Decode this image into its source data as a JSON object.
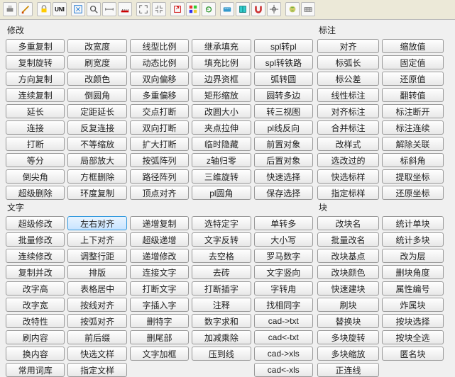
{
  "toolbar": [
    {
      "name": "print-icon"
    },
    {
      "name": "brush-icon"
    },
    {
      "name": "lock-icon"
    },
    {
      "name": "unit-icon"
    },
    {
      "name": "zoom-extents-icon"
    },
    {
      "name": "zoom-icon"
    },
    {
      "name": "measure-icon"
    },
    {
      "name": "ruler-icon"
    },
    {
      "name": "fullscreen-icon"
    },
    {
      "name": "contract-icon"
    },
    {
      "name": "export-icon"
    },
    {
      "name": "colors-icon"
    },
    {
      "name": "refresh-icon"
    },
    {
      "name": "keyboard-icon"
    },
    {
      "name": "book-icon"
    },
    {
      "name": "magnet-icon"
    },
    {
      "name": "crosshair-icon"
    },
    {
      "name": "globe-icon"
    },
    {
      "name": "grid-icon"
    }
  ],
  "sections": {
    "modify": {
      "title": "修改",
      "cols": 5,
      "buttons": [
        "多重复制",
        "改宽度",
        "线型比例",
        "继承填充",
        "spl转pl",
        "复制旋转",
        "刷宽度",
        "动态比例",
        "填充比例",
        "spl转铁路",
        "方向复制",
        "改颜色",
        "双向偏移",
        "边界资框",
        "弧转圆",
        "连续复制",
        "倒圆角",
        "多重偏移",
        "矩形缩放",
        "圆转多边",
        "延长",
        "定距延长",
        "交点打断",
        "改圆大小",
        "转三视图",
        "连接",
        "反复连接",
        "双向打断",
        "夹点拉伸",
        "pl线反向",
        "打断",
        "不等缩放",
        "扩大打断",
        "临时隐藏",
        "前置对象",
        "等分",
        "局部放大",
        "按弧阵列",
        "z轴归零",
        "后置对象",
        "倒尖角",
        "方框删除",
        "路径阵列",
        "三维旋转",
        "快速选择",
        "超级删除",
        "环度复制",
        "顶点对齐",
        "pl圆角",
        "保存选择"
      ]
    },
    "text": {
      "title": "文字",
      "cols": 5,
      "highlight": "左右对齐",
      "buttons": [
        "超级修改",
        "左右对齐",
        "递增复制",
        "选特定字",
        "单转多",
        "批量修改",
        "上下对齐",
        "超级递增",
        "文字反转",
        "大小写",
        "连续修改",
        "调整行距",
        "递增修改",
        "去空格",
        "罗马数字",
        "复制并改",
        "排版",
        "连接文字",
        "去砖",
        "文字竖向",
        "改字高",
        "表格居中",
        "打断文字",
        "打断插字",
        "字转甪",
        "改字宽",
        "按线对齐",
        "字插入字",
        "注释",
        "找相同字",
        "改特性",
        "按弧对齐",
        "删特字",
        "数字求和",
        "cad->txt",
        "刷内容",
        "前后缀",
        "删尾部",
        "加减乘除",
        "cad<-txt",
        "换内容",
        "快选文样",
        "文字加框",
        "压到线",
        "cad->xls",
        "常用词库",
        "指定文样",
        "",
        "",
        "cad<-xls"
      ]
    },
    "annot": {
      "title": "标注",
      "cols": 2,
      "buttons": [
        "对齐",
        "缩放值",
        "标弧长",
        "固定值",
        "标公差",
        "还原值",
        "线性标注",
        "翻转值",
        "对齐标注",
        "标注断开",
        "合并标注",
        "标注连续",
        "改样式",
        "解除关联",
        "选改过的",
        "标斜角",
        "快选标样",
        "提取坐标",
        "指定标样",
        "还原坐标"
      ]
    },
    "block": {
      "title": "块",
      "cols": 2,
      "buttons": [
        "改块名",
        "统计单块",
        "批量改名",
        "统计多块",
        "改块基点",
        "改为层",
        "改块颜色",
        "删块角度",
        "快速建块",
        "属性编号",
        "刷块",
        "炸属块",
        "替换块",
        "按块选择",
        "多块旋转",
        "按块全选",
        "多块缩放",
        "匿名块",
        "正连线",
        ""
      ]
    }
  }
}
